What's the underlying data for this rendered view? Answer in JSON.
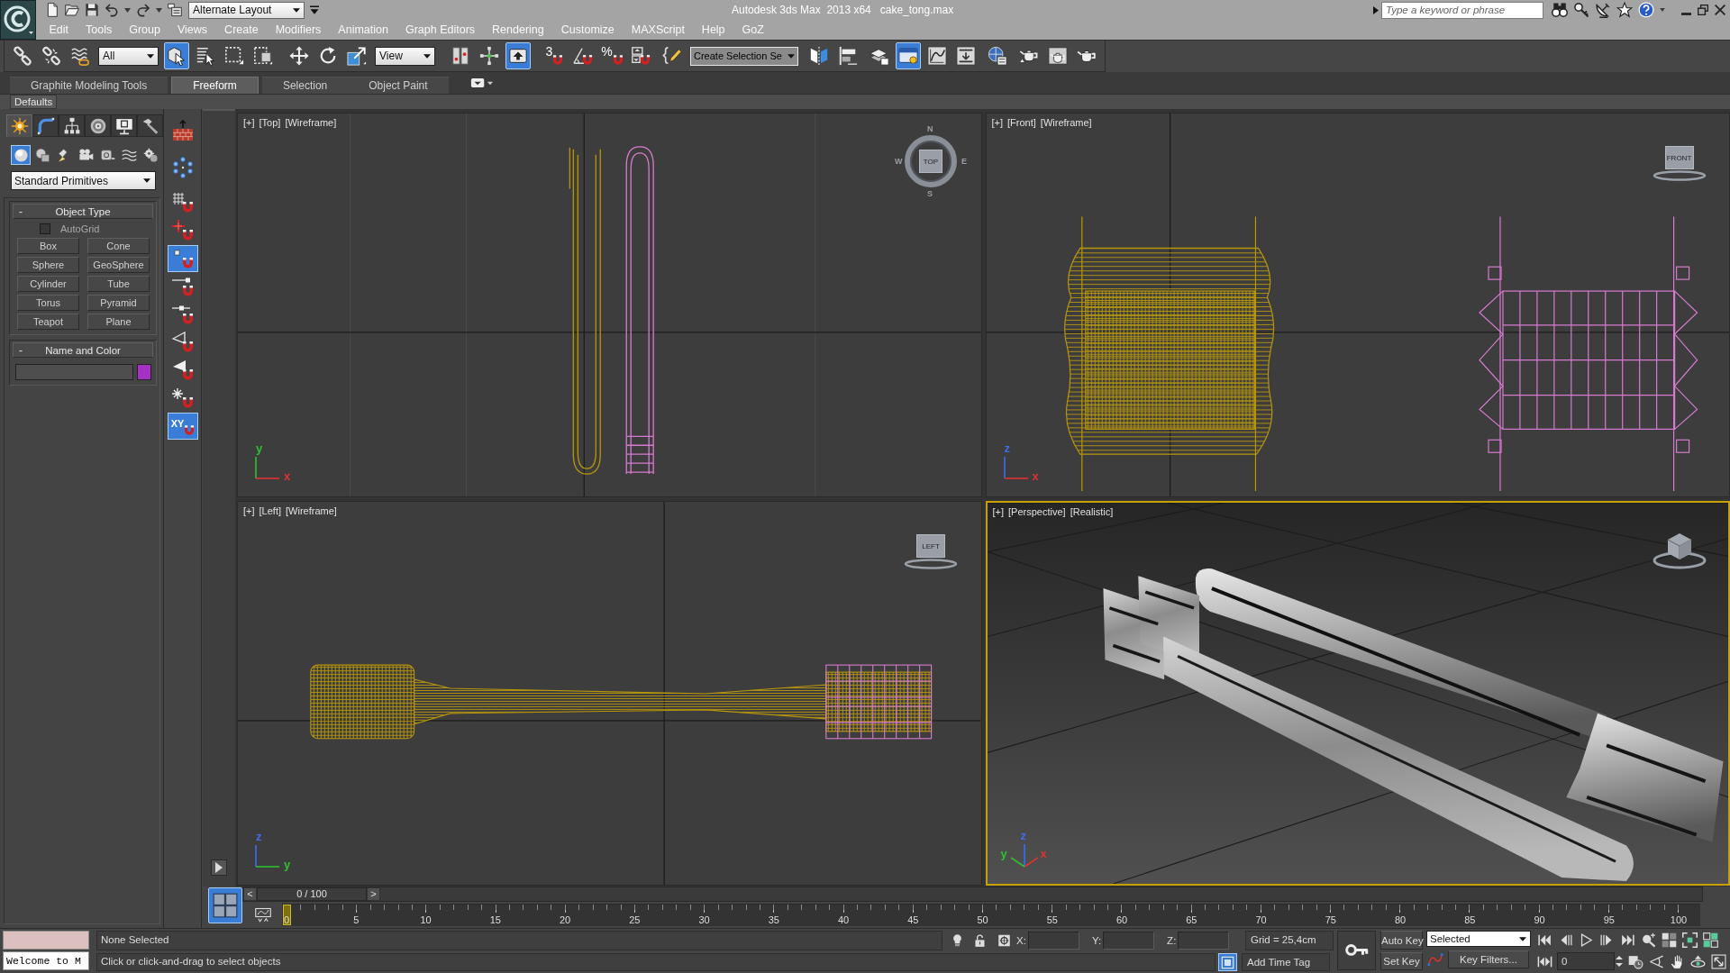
{
  "title_bar": {
    "workspace": "Alternate Layout",
    "title": "Autodesk 3ds Max  2013 x64",
    "file": "cake_tong.max",
    "search": {
      "placeholder": "Type a keyword or phrase"
    }
  },
  "menu_bar": [
    "Edit",
    "Tools",
    "Group",
    "Views",
    "Create",
    "Modifiers",
    "Animation",
    "Graph Editors",
    "Rendering",
    "Customize",
    "MAXScript",
    "Help",
    "GoZ"
  ],
  "main_toolbar": [
    {
      "kind": "link",
      "selected": false
    },
    {
      "kind": "unlink",
      "selected": false
    },
    {
      "kind": "bind",
      "selected": false
    },
    {
      "kind": "dropdown",
      "value": "All"
    },
    {
      "kind": "select",
      "selected": true
    },
    {
      "kind": "select_by_name",
      "selected": false
    },
    {
      "kind": "region",
      "selected": false
    },
    {
      "kind": "crossing",
      "selected": false
    },
    {
      "kind": "move",
      "selected": false
    },
    {
      "kind": "rotate",
      "selected": false
    },
    {
      "kind": "scale",
      "selected": false
    },
    {
      "kind": "dropdown",
      "value": "View"
    },
    {
      "kind": "pivot",
      "selected": false
    },
    {
      "kind": "manipulate",
      "selected": false
    },
    {
      "kind": "override",
      "selected": true
    },
    {
      "kind": "snap",
      "selected": false,
      "glyph": "3"
    },
    {
      "kind": "angle_snap",
      "selected": false
    },
    {
      "kind": "percent_snap",
      "selected": false,
      "glyph": "%"
    },
    {
      "kind": "spinner_snap",
      "selected": false
    },
    {
      "kind": "named_sets",
      "selected": false
    },
    {
      "kind": "combo",
      "value": "Create Selection Se"
    },
    {
      "kind": "mirror",
      "selected": false
    },
    {
      "kind": "align",
      "selected": false
    },
    {
      "kind": "layers",
      "selected": false
    },
    {
      "kind": "ribbon",
      "selected": true
    },
    {
      "kind": "curves",
      "selected": false
    },
    {
      "kind": "schematic",
      "selected": false
    },
    {
      "kind": "material",
      "selected": false
    },
    {
      "kind": "render_setup",
      "selected": false
    },
    {
      "kind": "frame_window",
      "selected": false
    },
    {
      "kind": "render",
      "selected": false
    }
  ],
  "ribbon": {
    "tabs": [
      {
        "label": "Graphite Modeling Tools",
        "selected": false
      },
      {
        "label": "Freeform",
        "selected": true
      },
      {
        "label": "Selection",
        "selected": false
      },
      {
        "label": "Object Paint",
        "selected": false
      }
    ],
    "panel": "Defaults"
  },
  "command_panel": {
    "tabs": [
      {
        "kind": "create",
        "selected": true
      },
      {
        "kind": "modify",
        "selected": false
      },
      {
        "kind": "hierarchy",
        "selected": false
      },
      {
        "kind": "motion",
        "selected": false
      },
      {
        "kind": "display",
        "selected": false
      },
      {
        "kind": "utilities",
        "selected": false
      }
    ],
    "categories": [
      {
        "kind": "geometry",
        "selected": true
      },
      {
        "kind": "shapes",
        "selected": false
      },
      {
        "kind": "lights",
        "selected": false
      },
      {
        "kind": "cameras",
        "selected": false
      },
      {
        "kind": "helpers",
        "selected": false
      },
      {
        "kind": "space_warps",
        "selected": false
      },
      {
        "kind": "systems",
        "selected": false
      }
    ],
    "dropdown": "Standard Primitives",
    "rollouts": [
      {
        "kind": "object_type",
        "toggle": "-",
        "title": "Object Type",
        "autogrid": {
          "label": "AutoGrid",
          "checked": false
        },
        "buttons": [
          "Box",
          "Cone",
          "Sphere",
          "GeoSphere",
          "Cylinder",
          "Tube",
          "Torus",
          "Pyramid",
          "Teapot",
          "Plane"
        ]
      },
      {
        "kind": "name_color",
        "toggle": "-",
        "title": "Name and Color",
        "color": "#a630c2"
      }
    ]
  },
  "snap_toolbar": [
    {
      "kind": "containers",
      "selected": false
    },
    {
      "kind": "particles",
      "selected": false
    },
    {
      "kind": "grid_points",
      "selected": false
    },
    {
      "kind": "pivot",
      "selected": false
    },
    {
      "kind": "vertex",
      "selected": true
    },
    {
      "kind": "endpoint",
      "selected": false
    },
    {
      "kind": "midpoint",
      "selected": false
    },
    {
      "kind": "edge",
      "selected": false
    },
    {
      "kind": "face",
      "selected": false
    },
    {
      "kind": "perpendicular",
      "selected": false
    },
    {
      "kind": "xy",
      "selected": true,
      "glyph": "XY"
    }
  ],
  "viewports": [
    {
      "kind": "top",
      "labels": [
        "[+]",
        "[Top]",
        "[Wireframe]"
      ],
      "selected": false,
      "viewcube": {
        "kind": "compass",
        "label": "TOP",
        "compass": [
          "N",
          "E",
          "S",
          "W"
        ]
      },
      "axes": [
        {
          "label": "y",
          "color": "#2fc02f"
        },
        {
          "label": "x",
          "color": "#e03232"
        }
      ]
    },
    {
      "kind": "front",
      "labels": [
        "[+]",
        "[Front]",
        "[Wireframe]"
      ],
      "selected": false,
      "viewcube": {
        "kind": "flat",
        "label": "FRONT"
      },
      "axes": [
        {
          "label": "z",
          "color": "#3f6cf0"
        },
        {
          "label": "x",
          "color": "#e03232"
        }
      ]
    },
    {
      "kind": "left",
      "labels": [
        "[+]",
        "[Left]",
        "[Wireframe]"
      ],
      "selected": false,
      "viewcube": {
        "kind": "flat",
        "label": "LEFT"
      },
      "axes": [
        {
          "label": "z",
          "color": "#3f6cf0"
        },
        {
          "label": "y",
          "color": "#2fc02f"
        }
      ]
    },
    {
      "kind": "perspective",
      "labels": [
        "[+]",
        "[Perspective]",
        "[Realistic]"
      ],
      "selected": true,
      "viewcube": {
        "kind": "cube"
      },
      "axes": [
        {
          "label": "z",
          "color": "#3f6cf0"
        },
        {
          "label": "x",
          "color": "#e03232"
        },
        {
          "label": "y",
          "color": "#2fc02f"
        }
      ]
    }
  ],
  "timeline": {
    "time_slider": {
      "prev": "<",
      "label": "0 / 100",
      "next": ">",
      "level": 0
    },
    "ticks": [
      "0",
      "5",
      "10",
      "15",
      "20",
      "25",
      "30",
      "35",
      "40",
      "45",
      "50",
      "55",
      "60",
      "65",
      "70",
      "75",
      "80",
      "85",
      "90",
      "95",
      "100"
    ]
  },
  "status_bar": {
    "listener": "Welcome to M",
    "selection": "None Selected",
    "prompt": "Click or click-and-drag to select objects",
    "coords": [
      "X:",
      "Y:",
      "Z:"
    ],
    "grid": "Grid = 25,4cm",
    "time_tag": "Add Time Tag",
    "auto_key": {
      "label": "Auto Key",
      "on": false
    },
    "set_key": "Set Key",
    "key_set": "Selected",
    "key_filters": "Key Filters...",
    "frame": "0"
  }
}
